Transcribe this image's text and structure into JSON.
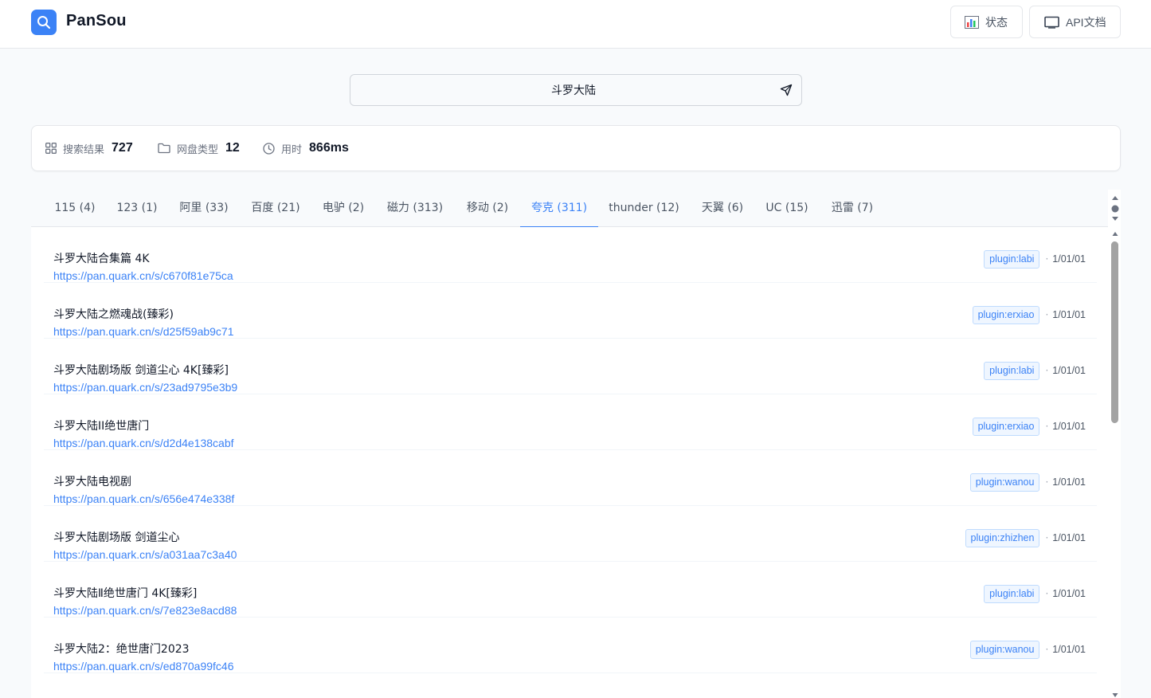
{
  "header": {
    "app_title": "PanSou",
    "status_label": "状态",
    "api_docs_label": "API文档"
  },
  "search": {
    "query": "斗罗大陆",
    "placeholder": ""
  },
  "stats": {
    "results_label": "搜索结果",
    "results_value": "727",
    "types_label": "网盘类型",
    "types_value": "12",
    "time_label": "用时",
    "time_value": "866ms"
  },
  "tabs": [
    {
      "label": "115 (4)"
    },
    {
      "label": "123 (1)"
    },
    {
      "label": "阿里 (33)"
    },
    {
      "label": "百度 (21)"
    },
    {
      "label": "电驴 (2)"
    },
    {
      "label": "磁力 (313)"
    },
    {
      "label": "移动 (2)"
    },
    {
      "label": "夸克 (311)"
    },
    {
      "label": "thunder (12)"
    },
    {
      "label": "天翼 (6)"
    },
    {
      "label": "UC (15)"
    },
    {
      "label": "迅雷 (7)"
    }
  ],
  "active_tab": "夸克 (311)",
  "results": [
    {
      "title": "斗罗大陆合集篇 4K",
      "link": "https://pan.quark.cn/s/c670f81e75ca",
      "source": "plugin:labi",
      "date": "1/01/01"
    },
    {
      "title": "斗罗大陆之燃魂战(臻彩)",
      "link": "https://pan.quark.cn/s/d25f59ab9c71",
      "source": "plugin:erxiao",
      "date": "1/01/01"
    },
    {
      "title": "斗罗大陆剧场版 剑道尘心 4K[臻彩]",
      "link": "https://pan.quark.cn/s/23ad9795e3b9",
      "source": "plugin:labi",
      "date": "1/01/01"
    },
    {
      "title": "斗罗大陆II绝世唐门",
      "link": "https://pan.quark.cn/s/d2d4e138cabf",
      "source": "plugin:erxiao",
      "date": "1/01/01"
    },
    {
      "title": "斗罗大陆电视剧",
      "link": "https://pan.quark.cn/s/656e474e338f",
      "source": "plugin:wanou",
      "date": "1/01/01"
    },
    {
      "title": "斗罗大陆剧场版 剑道尘心",
      "link": "https://pan.quark.cn/s/a031aa7c3a40",
      "source": "plugin:zhizhen",
      "date": "1/01/01"
    },
    {
      "title": "斗罗大陆Ⅱ绝世唐门 4K[臻彩]",
      "link": "https://pan.quark.cn/s/7e823e8acd88",
      "source": "plugin:labi",
      "date": "1/01/01"
    },
    {
      "title": "斗罗大陆2：绝世唐门2023",
      "link": "https://pan.quark.cn/s/ed870a99fc46",
      "source": "plugin:wanou",
      "date": "1/01/01"
    }
  ],
  "colors": {
    "accent": "#3b82f6",
    "border": "#e5e7eb",
    "tag_bg": "#eff6ff"
  }
}
